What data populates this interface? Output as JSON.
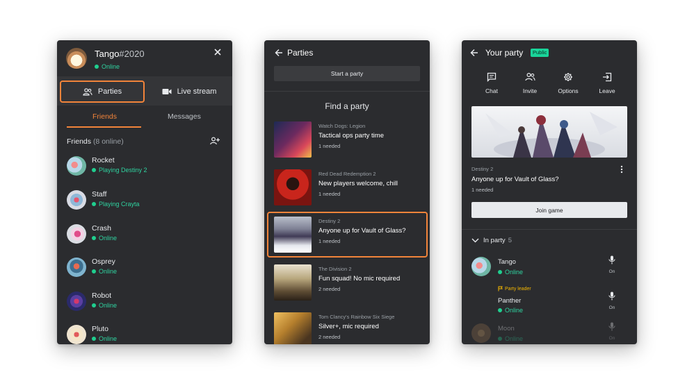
{
  "panel_friends": {
    "user_name": "Tango",
    "user_tag": "#2020",
    "user_status": "Online",
    "tabs": {
      "parties": "Parties",
      "live_stream": "Live stream"
    },
    "subtabs": {
      "friends": "Friends",
      "messages": "Messages"
    },
    "friends_heading": "Friends",
    "friends_count": "(8 online)",
    "friends": [
      {
        "name": "Rocket",
        "status": "Playing Destiny 2"
      },
      {
        "name": "Staff",
        "status": "Playing Crayta"
      },
      {
        "name": "Crash",
        "status": "Online"
      },
      {
        "name": "Osprey",
        "status": "Online"
      },
      {
        "name": "Robot",
        "status": "Online"
      },
      {
        "name": "Pluto",
        "status": "Online"
      }
    ]
  },
  "panel_parties": {
    "title": "Parties",
    "start_button": "Start a party",
    "find_heading": "Find a party",
    "parties": [
      {
        "game": "Watch Dogs: Legion",
        "title": "Tactical ops party time",
        "need": "1 needed"
      },
      {
        "game": "Red Dead Redemption 2",
        "title": "New players welcome, chill",
        "need": "1 needed"
      },
      {
        "game": "Destiny 2",
        "title": "Anyone up for Vault of Glass?",
        "need": "1 needed"
      },
      {
        "game": "The Division 2",
        "title": "Fun squad! No mic required",
        "need": "2 needed"
      },
      {
        "game": "Tom Clancy's Rainbow Six Siege",
        "title": "Silver+, mic required",
        "need": "2 needed"
      }
    ]
  },
  "panel_party": {
    "title": "Your party",
    "badge": "Public",
    "actions": [
      "Chat",
      "Invite",
      "Options",
      "Leave"
    ],
    "game": "Destiny 2",
    "party_title": "Anyone up for Vault of Glass?",
    "need": "1 needed",
    "join_button": "Join game",
    "in_party_label": "In party",
    "in_party_count": "5",
    "leader_label": "Party leader",
    "members": [
      {
        "name": "Tango",
        "status": "Online",
        "mic": "On"
      },
      {
        "name": "Panther",
        "status": "Online",
        "mic": "On"
      },
      {
        "name": "Moon",
        "status": "Online",
        "mic": "On"
      }
    ]
  },
  "colors": {
    "accent": "#f2843a",
    "online": "#1fcf8f",
    "public_badge": "#19d49a",
    "panel_bg": "#2b2c2f"
  },
  "icons": [
    "close-icon",
    "people-icon",
    "video-camera-icon",
    "add-person-icon",
    "back-arrow-icon",
    "chat-icon",
    "invite-icon",
    "settings-icon",
    "leave-icon",
    "more-vert-icon",
    "chevron-down-icon",
    "mic-icon",
    "flag-icon"
  ]
}
